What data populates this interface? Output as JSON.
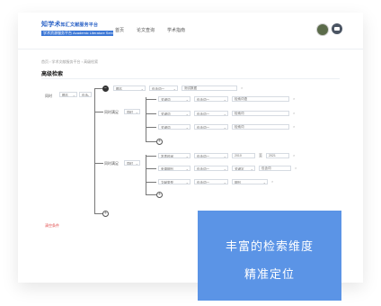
{
  "app": {
    "logo_main": "知学术",
    "logo_suffix": "知汇文献服务平台",
    "logo_sub": "学术资源服务平台 Academic Literature Service"
  },
  "nav": [
    "首页",
    "论文查询",
    "学术指南"
  ],
  "breadcrumb": "首页 › 学术文献服务平台 › 高级检索",
  "page_title": "高级检索",
  "root": {
    "relation": "同时",
    "field": "题名",
    "op": "包含"
  },
  "first_row": {
    "field": "题名",
    "match": "包含词一",
    "value": "测试数据"
  },
  "group1": {
    "label": "同时满足",
    "relation": "同时",
    "rows": [
      {
        "field": "关键词",
        "match": "包含词一",
        "value": "检索词语"
      },
      {
        "field": "关键词",
        "match": "包含词一",
        "value": "检索词"
      },
      {
        "field": "关键词",
        "match": "包含词一",
        "value": "检索词"
      }
    ]
  },
  "group2": {
    "label": "同时满足",
    "relation": "同时",
    "rows": [
      {
        "field": "发表时间",
        "match": "包含词一",
        "from": "2010",
        "to": "2021"
      },
      {
        "field": "来源期刊",
        "match": "包含词一",
        "value": "关键字",
        "extra": "包含词"
      },
      {
        "field": "文献类型",
        "match": "包含词一",
        "value": "期刊"
      }
    ]
  },
  "to_label": "至",
  "clear_link": "清空条件",
  "ghost_text": "检索条件",
  "overlay": {
    "line1": "丰富的检索维度",
    "line2": "精准定位"
  },
  "colors": {
    "accent": "#5b94e6",
    "brand": "#2c63c6",
    "danger": "#e04848"
  }
}
